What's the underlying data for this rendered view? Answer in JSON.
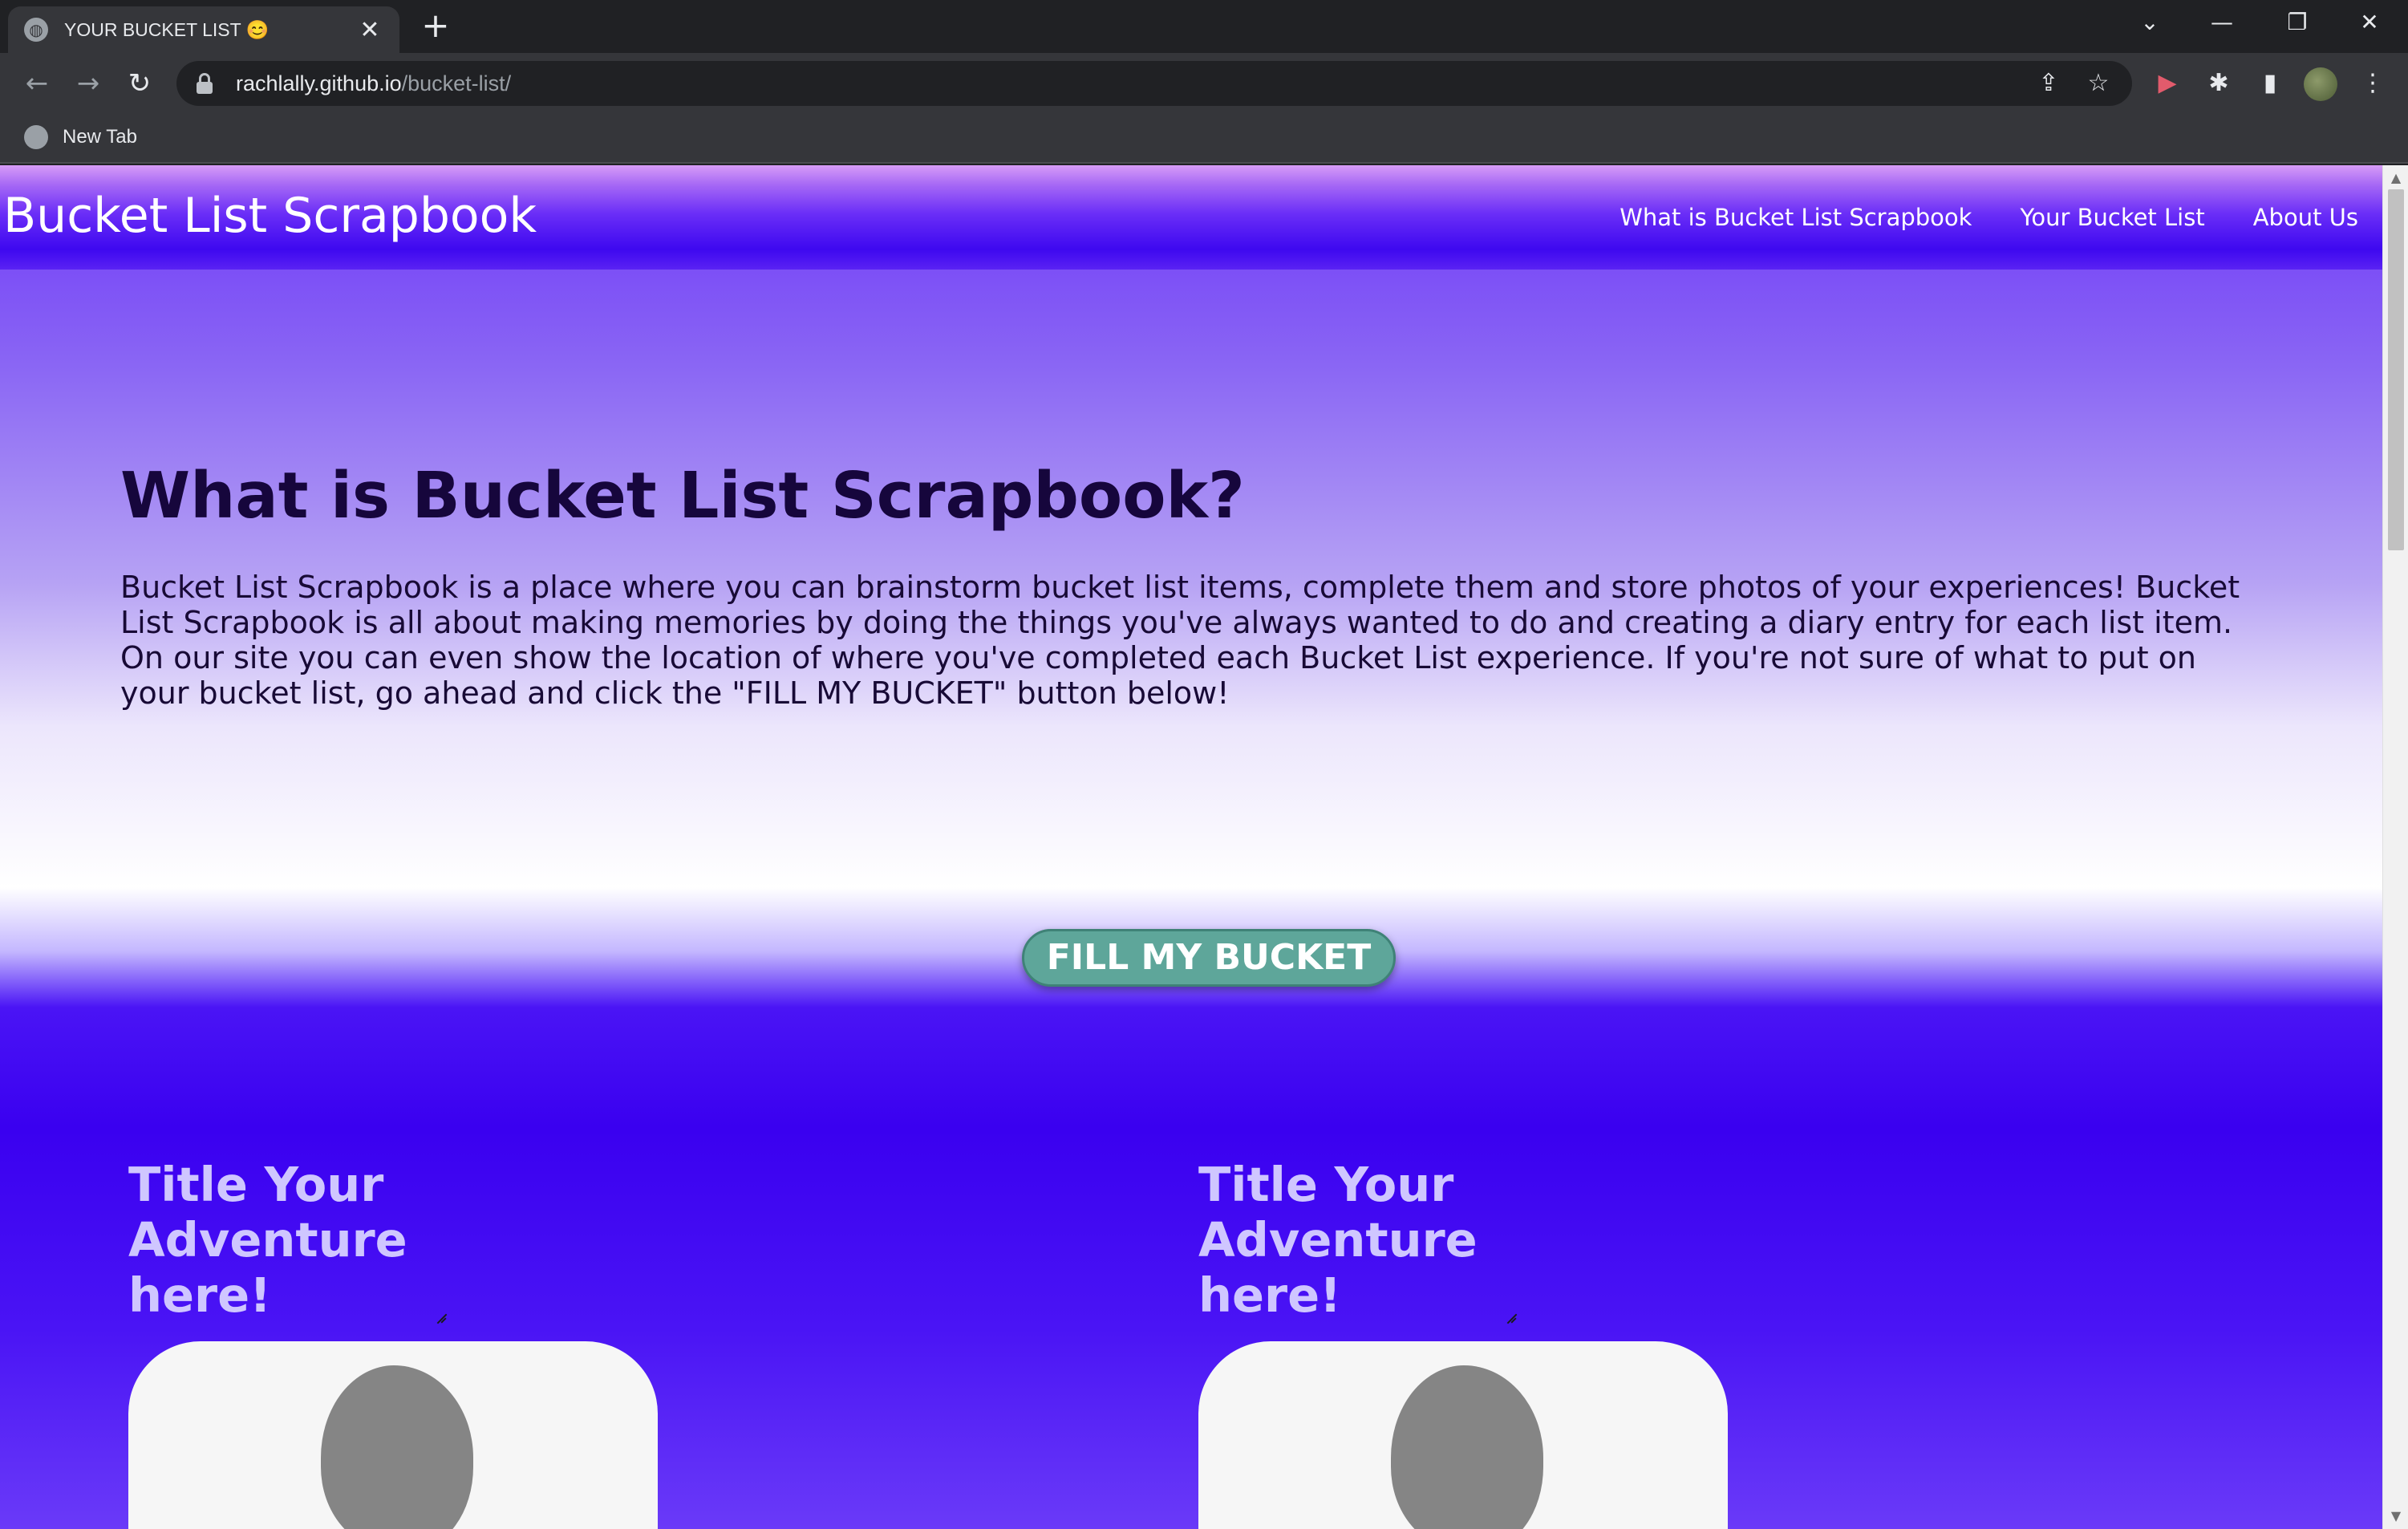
{
  "browser": {
    "tab_title": "YOUR BUCKET LIST 😊",
    "url_host": "rachlally.github.io",
    "url_path": "/bucket-list/",
    "bookmark": "New Tab"
  },
  "site": {
    "logo": "Bucket List Scrapbook",
    "nav": [
      "What is Bucket List Scrapbook",
      "Your Bucket List",
      "About Us"
    ]
  },
  "intro": {
    "heading": "What is Bucket List Scrapbook?",
    "body": "Bucket List Scrapbook is a place where you can brainstorm bucket list items, complete them and store photos of your experiences! Bucket List Scrapbook is all about making memories by doing the things you've always wanted to do and creating a diary entry for each list item. On our site you can even show the location of where you've completed each Bucket List experience. If you're not sure of what to put on your bucket list, go ahead and click the \"FILL MY BUCKET\" button below!"
  },
  "fill_button": "FILL MY BUCKET",
  "cards": [
    {
      "title": "Title Your Adventure here!"
    },
    {
      "title": "Title Your Adventure here!"
    }
  ],
  "colors": {
    "accent_button": "#5ea69a",
    "heading_dark": "#16063c",
    "card_title": "#cfc6ff"
  }
}
